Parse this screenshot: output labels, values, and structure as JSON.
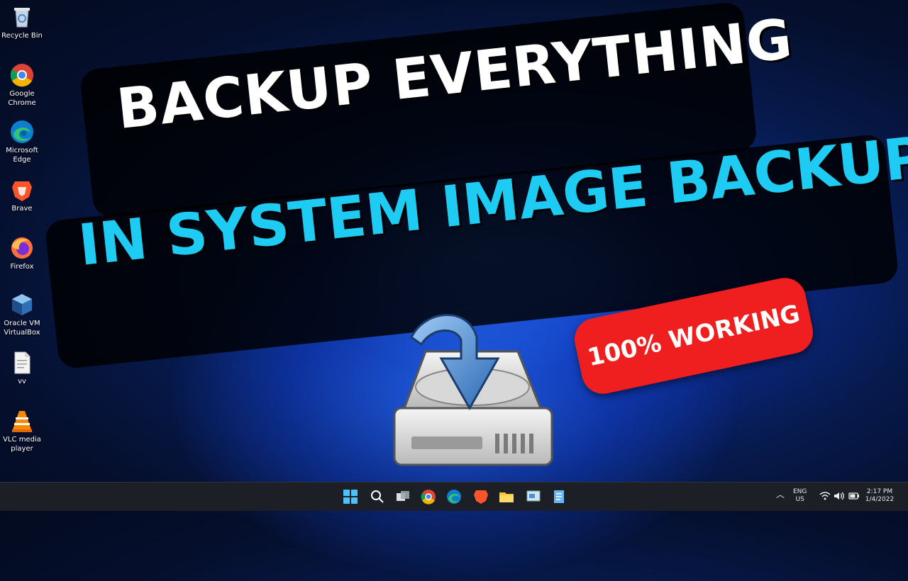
{
  "desktop_icons": [
    {
      "label": "Recycle Bin",
      "icon": "recycle-bin-icon"
    },
    {
      "label": "Google Chrome",
      "icon": "chrome-icon"
    },
    {
      "label": "Microsoft Edge",
      "icon": "edge-icon"
    },
    {
      "label": "Brave",
      "icon": "brave-icon"
    },
    {
      "label": "Firefox",
      "icon": "firefox-icon"
    },
    {
      "label": "Oracle VM VirtualBox",
      "icon": "virtualbox-icon"
    },
    {
      "label": "vv",
      "icon": "text-file-icon"
    },
    {
      "label": "VLC media player",
      "icon": "vlc-icon"
    }
  ],
  "headline": {
    "line1": "BACKUP EVERYTHING",
    "line2": "IN SYSTEM IMAGE BACKUP"
  },
  "badge": {
    "text": "100% WORKING"
  },
  "taskbar": {
    "apps": [
      "start-icon",
      "search-icon",
      "task-view-icon",
      "chrome-icon",
      "edge-icon",
      "brave-icon",
      "file-explorer-icon",
      "control-panel-icon",
      "notepad-icon"
    ],
    "language_line1": "ENG",
    "language_line2": "US",
    "time": "2:17 PM",
    "date": "1/4/2022"
  },
  "colors": {
    "line1": "#ffffff",
    "line2": "#1ecbf2",
    "badge": "#f01f1f",
    "taskbar": "#1c1f26"
  }
}
